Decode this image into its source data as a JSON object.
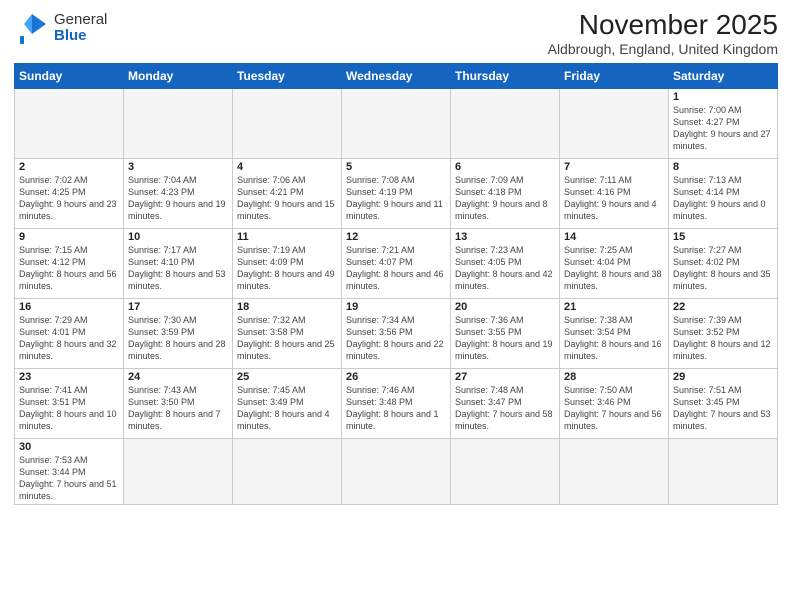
{
  "logo": {
    "line1": "General",
    "line2": "Blue"
  },
  "title": "November 2025",
  "subtitle": "Aldbrough, England, United Kingdom",
  "days_of_week": [
    "Sunday",
    "Monday",
    "Tuesday",
    "Wednesday",
    "Thursday",
    "Friday",
    "Saturday"
  ],
  "weeks": [
    [
      {
        "day": "",
        "info": ""
      },
      {
        "day": "",
        "info": ""
      },
      {
        "day": "",
        "info": ""
      },
      {
        "day": "",
        "info": ""
      },
      {
        "day": "",
        "info": ""
      },
      {
        "day": "",
        "info": ""
      },
      {
        "day": "1",
        "info": "Sunrise: 7:00 AM\nSunset: 4:27 PM\nDaylight: 9 hours and 27 minutes."
      }
    ],
    [
      {
        "day": "2",
        "info": "Sunrise: 7:02 AM\nSunset: 4:25 PM\nDaylight: 9 hours and 23 minutes."
      },
      {
        "day": "3",
        "info": "Sunrise: 7:04 AM\nSunset: 4:23 PM\nDaylight: 9 hours and 19 minutes."
      },
      {
        "day": "4",
        "info": "Sunrise: 7:06 AM\nSunset: 4:21 PM\nDaylight: 9 hours and 15 minutes."
      },
      {
        "day": "5",
        "info": "Sunrise: 7:08 AM\nSunset: 4:19 PM\nDaylight: 9 hours and 11 minutes."
      },
      {
        "day": "6",
        "info": "Sunrise: 7:09 AM\nSunset: 4:18 PM\nDaylight: 9 hours and 8 minutes."
      },
      {
        "day": "7",
        "info": "Sunrise: 7:11 AM\nSunset: 4:16 PM\nDaylight: 9 hours and 4 minutes."
      },
      {
        "day": "8",
        "info": "Sunrise: 7:13 AM\nSunset: 4:14 PM\nDaylight: 9 hours and 0 minutes."
      }
    ],
    [
      {
        "day": "9",
        "info": "Sunrise: 7:15 AM\nSunset: 4:12 PM\nDaylight: 8 hours and 56 minutes."
      },
      {
        "day": "10",
        "info": "Sunrise: 7:17 AM\nSunset: 4:10 PM\nDaylight: 8 hours and 53 minutes."
      },
      {
        "day": "11",
        "info": "Sunrise: 7:19 AM\nSunset: 4:09 PM\nDaylight: 8 hours and 49 minutes."
      },
      {
        "day": "12",
        "info": "Sunrise: 7:21 AM\nSunset: 4:07 PM\nDaylight: 8 hours and 46 minutes."
      },
      {
        "day": "13",
        "info": "Sunrise: 7:23 AM\nSunset: 4:05 PM\nDaylight: 8 hours and 42 minutes."
      },
      {
        "day": "14",
        "info": "Sunrise: 7:25 AM\nSunset: 4:04 PM\nDaylight: 8 hours and 38 minutes."
      },
      {
        "day": "15",
        "info": "Sunrise: 7:27 AM\nSunset: 4:02 PM\nDaylight: 8 hours and 35 minutes."
      }
    ],
    [
      {
        "day": "16",
        "info": "Sunrise: 7:29 AM\nSunset: 4:01 PM\nDaylight: 8 hours and 32 minutes."
      },
      {
        "day": "17",
        "info": "Sunrise: 7:30 AM\nSunset: 3:59 PM\nDaylight: 8 hours and 28 minutes."
      },
      {
        "day": "18",
        "info": "Sunrise: 7:32 AM\nSunset: 3:58 PM\nDaylight: 8 hours and 25 minutes."
      },
      {
        "day": "19",
        "info": "Sunrise: 7:34 AM\nSunset: 3:56 PM\nDaylight: 8 hours and 22 minutes."
      },
      {
        "day": "20",
        "info": "Sunrise: 7:36 AM\nSunset: 3:55 PM\nDaylight: 8 hours and 19 minutes."
      },
      {
        "day": "21",
        "info": "Sunrise: 7:38 AM\nSunset: 3:54 PM\nDaylight: 8 hours and 16 minutes."
      },
      {
        "day": "22",
        "info": "Sunrise: 7:39 AM\nSunset: 3:52 PM\nDaylight: 8 hours and 12 minutes."
      }
    ],
    [
      {
        "day": "23",
        "info": "Sunrise: 7:41 AM\nSunset: 3:51 PM\nDaylight: 8 hours and 10 minutes."
      },
      {
        "day": "24",
        "info": "Sunrise: 7:43 AM\nSunset: 3:50 PM\nDaylight: 8 hours and 7 minutes."
      },
      {
        "day": "25",
        "info": "Sunrise: 7:45 AM\nSunset: 3:49 PM\nDaylight: 8 hours and 4 minutes."
      },
      {
        "day": "26",
        "info": "Sunrise: 7:46 AM\nSunset: 3:48 PM\nDaylight: 8 hours and 1 minute."
      },
      {
        "day": "27",
        "info": "Sunrise: 7:48 AM\nSunset: 3:47 PM\nDaylight: 7 hours and 58 minutes."
      },
      {
        "day": "28",
        "info": "Sunrise: 7:50 AM\nSunset: 3:46 PM\nDaylight: 7 hours and 56 minutes."
      },
      {
        "day": "29",
        "info": "Sunrise: 7:51 AM\nSunset: 3:45 PM\nDaylight: 7 hours and 53 minutes."
      }
    ],
    [
      {
        "day": "30",
        "info": "Sunrise: 7:53 AM\nSunset: 3:44 PM\nDaylight: 7 hours and 51 minutes."
      },
      {
        "day": "",
        "info": ""
      },
      {
        "day": "",
        "info": ""
      },
      {
        "day": "",
        "info": ""
      },
      {
        "day": "",
        "info": ""
      },
      {
        "day": "",
        "info": ""
      },
      {
        "day": "",
        "info": ""
      }
    ]
  ]
}
